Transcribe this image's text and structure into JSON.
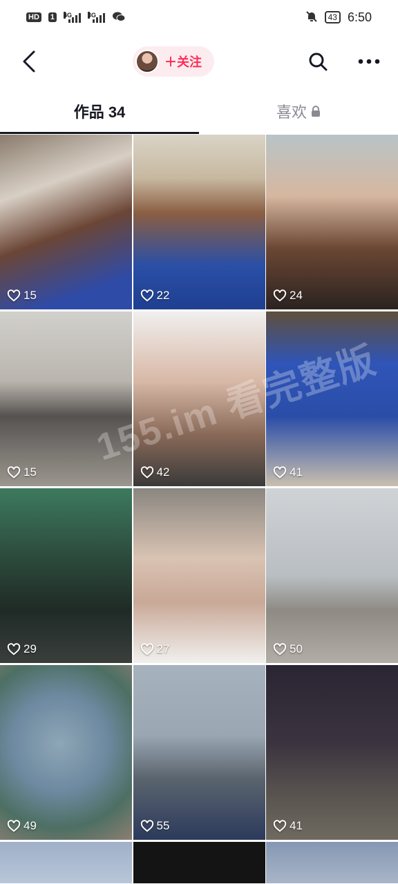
{
  "status_bar": {
    "left_badges": [
      "HD",
      "1"
    ],
    "network_labels": [
      "4G",
      "3G"
    ],
    "battery": "43",
    "time": "6:50"
  },
  "header": {
    "follow_label": "＋关注",
    "icons": [
      "back-arrow-icon",
      "search-icon",
      "more-icon"
    ]
  },
  "tabs": [
    {
      "label": "作品 34",
      "active": true
    },
    {
      "label": "喜欢",
      "locked": true
    }
  ],
  "videos": [
    {
      "likes": "15"
    },
    {
      "likes": "22"
    },
    {
      "likes": "24"
    },
    {
      "likes": "15"
    },
    {
      "likes": "42"
    },
    {
      "likes": "41"
    },
    {
      "likes": "29"
    },
    {
      "likes": "27"
    },
    {
      "likes": "50"
    },
    {
      "likes": "49"
    },
    {
      "likes": "55"
    },
    {
      "likes": "41"
    }
  ],
  "watermark": "155.im 看完整版",
  "colors": {
    "accent": "#fe2c55",
    "pill_bg": "#fdecef",
    "text": "#161823",
    "muted": "#8a8b91"
  }
}
